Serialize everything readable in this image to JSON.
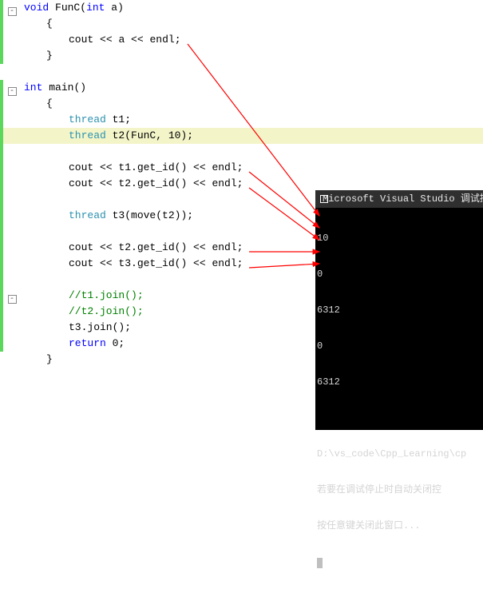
{
  "code": {
    "func_sig": {
      "kw": "void",
      "name": "FunC",
      "params_open": "(",
      "ptype": "int",
      "pname": "a",
      "params_close": ")"
    },
    "brace_open": "{",
    "brace_close": "}",
    "func_body": {
      "cout": "cout",
      "op1": " << ",
      "var": "a",
      "op2": " << ",
      "endl": "endl",
      "semi": ";"
    },
    "main_sig": {
      "kw": "int",
      "name": "main",
      "parens": "()"
    },
    "t1_decl": {
      "cls": "thread",
      "rest": " t1;"
    },
    "t2_decl": {
      "cls": "thread",
      "rest": " t2(FunC, 10);"
    },
    "cout_t1_id": {
      "pre": "cout << t1.",
      "fn": "get_id",
      "post": "() << endl;"
    },
    "cout_t2_id": {
      "pre": "cout << t2.",
      "fn": "get_id",
      "post": "() << endl;"
    },
    "t3_decl": {
      "cls": "thread",
      "rest": " t3(",
      "fn": "move",
      "post": "(t2));"
    },
    "cout_t2_id2": {
      "pre": "cout << t2.",
      "fn": "get_id",
      "post": "() << endl;"
    },
    "cout_t3_id": {
      "pre": "cout << t3.",
      "fn": "get_id",
      "post": "() << endl;"
    },
    "cmt1": "//t1.join();",
    "cmt2": "//t2.join();",
    "t3_join": "t3.join();",
    "ret": {
      "kw": "return",
      "rest": " 0;"
    }
  },
  "console": {
    "title": "Microsoft Visual Studio 调试控",
    "lines": [
      "10",
      "0",
      "6312",
      "0",
      "6312",
      "",
      "D:\\vs_code\\Cpp_Learning\\cp",
      "若要在调试停止时自动关闭控",
      "按任意键关闭此窗口..."
    ]
  }
}
